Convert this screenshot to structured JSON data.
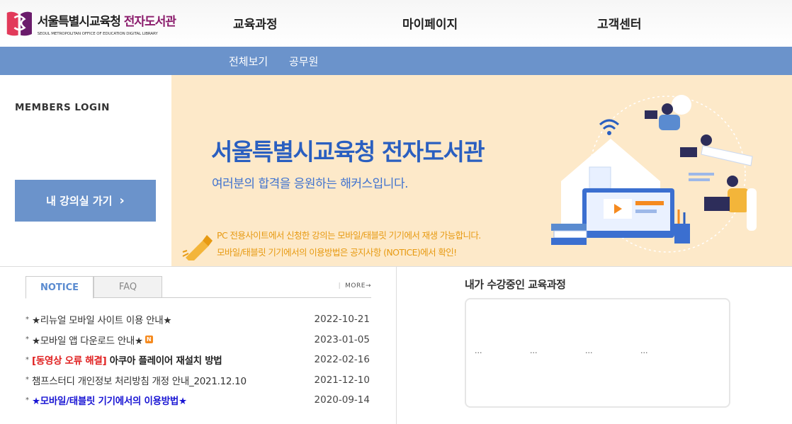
{
  "header": {
    "logo_title": "서울특별시교육청",
    "logo_accent": "전자도서관",
    "logo_subtitle": "SEOUL METROPOLITAN OFFICE OF EDUCATION DIGITAL LIBRARY",
    "nav": [
      "교육과정",
      "마이페이지",
      "고객센터"
    ]
  },
  "subnav": [
    "전체보기",
    "공무원"
  ],
  "login": {
    "title": "MEMBERS LOGIN",
    "button_label": "내 강의실 가기",
    "button_icon": "chevron-right-icon"
  },
  "banner": {
    "title": "서울특별시교육청 전자도서관",
    "subtitle": "여러분의 합격을 응원하는 해커스입니다.",
    "note1": "PC 전용사이트에서 신청한 강의는 모바일/태블릿 기기에서 재생 가능합니다.",
    "note2": "모바일/태블릿 기기에서의 이용방법은 공지사항 (NOTICE)에서 확인!"
  },
  "notice": {
    "tabs": [
      "NOTICE",
      "FAQ"
    ],
    "more": "MORE",
    "items": [
      {
        "bullet": "*",
        "title": "★리뉴얼 모바일 사이트 이용 안내★",
        "date": "2022-10-21"
      },
      {
        "bullet": "*",
        "title": "★모바일 앱 다운로드 안내★",
        "badge": "N",
        "date": "2023-01-05"
      },
      {
        "bullet": "*",
        "prefix": "[동영상 오류 해결]",
        "title": " 아쿠아 플레이어 재설치 방법",
        "date": "2022-02-16"
      },
      {
        "bullet": "*",
        "title": "챔프스터디 개인정보 처리방침 개정 안내_2021.12.10",
        "date": "2021-12-10"
      },
      {
        "bullet": "*",
        "title": "★모바일/태블릿 기기에서의 이용방법★",
        "date": "2020-09-14"
      }
    ]
  },
  "mycourse": {
    "title": "내가 수강중인 교육과정",
    "placeholders": [
      "...",
      "...",
      "...",
      "..."
    ]
  },
  "colors": {
    "accent_blue": "#6b93cb",
    "banner_bg": "#fde9c9",
    "banner_title": "#2a5fc0",
    "notice_orange": "#e79a12",
    "logo_accent": "#8a1b6b"
  }
}
